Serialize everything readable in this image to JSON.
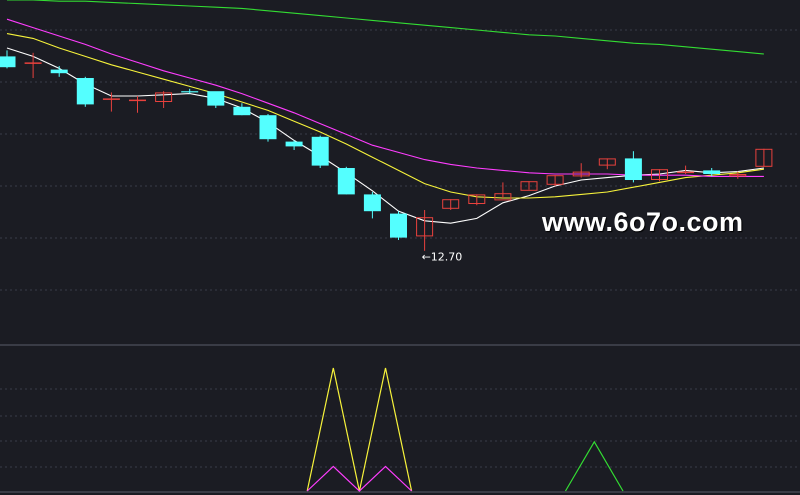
{
  "watermark": "www.6o7o.com",
  "colors": {
    "background": "#1b1c23",
    "grid": "#3a3d48",
    "up": "#e8413d",
    "down": "#54ffff",
    "ma5": "#ffffff",
    "ma10": "#f7f33b",
    "ma20": "#ff3dff",
    "ma60": "#33dd33",
    "low_label": "#ffffff"
  },
  "chart_data": {
    "type": "candlestick",
    "price_range": [
      12.17,
      14.82
    ],
    "low_marker": {
      "index": 16,
      "label": "←12.70",
      "value": 12.7
    },
    "candles": [
      {
        "o": 14.35,
        "h": 14.4,
        "l": 14.25,
        "c": 14.26
      },
      {
        "o": 14.3,
        "h": 14.38,
        "l": 14.17,
        "c": 14.3
      },
      {
        "o": 14.24,
        "h": 14.27,
        "l": 14.18,
        "c": 14.21
      },
      {
        "o": 14.17,
        "h": 14.18,
        "l": 13.93,
        "c": 13.95
      },
      {
        "o": 14.0,
        "h": 14.05,
        "l": 13.89,
        "c": 14.0
      },
      {
        "o": 13.99,
        "h": 14.02,
        "l": 13.88,
        "c": 13.99
      },
      {
        "o": 13.97,
        "h": 14.06,
        "l": 13.92,
        "c": 14.05
      },
      {
        "o": 14.06,
        "h": 14.08,
        "l": 14.04,
        "c": 14.05
      },
      {
        "o": 14.06,
        "h": 14.03,
        "l": 13.92,
        "c": 13.94
      },
      {
        "o": 13.93,
        "h": 13.96,
        "l": 13.86,
        "c": 13.86
      },
      {
        "o": 13.86,
        "h": 13.87,
        "l": 13.64,
        "c": 13.66
      },
      {
        "o": 13.64,
        "h": 13.65,
        "l": 13.57,
        "c": 13.6
      },
      {
        "o": 13.68,
        "h": 13.69,
        "l": 13.42,
        "c": 13.44
      },
      {
        "o": 13.42,
        "h": 13.43,
        "l": 13.2,
        "c": 13.2
      },
      {
        "o": 13.2,
        "h": 13.22,
        "l": 13.0,
        "c": 13.06
      },
      {
        "o": 13.04,
        "h": 13.06,
        "l": 12.82,
        "c": 12.84
      },
      {
        "o": 12.85,
        "h": 13.07,
        "l": 12.73,
        "c": 13.01
      },
      {
        "o": 13.08,
        "h": 13.16,
        "l": 13.07,
        "c": 13.16
      },
      {
        "o": 13.12,
        "h": 13.2,
        "l": 13.11,
        "c": 13.2
      },
      {
        "o": 13.15,
        "h": 13.3,
        "l": 13.17,
        "c": 13.21
      },
      {
        "o": 13.23,
        "h": 13.31,
        "l": 13.24,
        "c": 13.31
      },
      {
        "o": 13.28,
        "h": 13.36,
        "l": 13.27,
        "c": 13.36
      },
      {
        "o": 13.35,
        "h": 13.46,
        "l": 13.34,
        "c": 13.39
      },
      {
        "o": 13.44,
        "h": 13.5,
        "l": 13.41,
        "c": 13.5
      },
      {
        "o": 13.5,
        "h": 13.56,
        "l": 13.3,
        "c": 13.32
      },
      {
        "o": 13.32,
        "h": 13.41,
        "l": 13.31,
        "c": 13.41
      },
      {
        "o": 13.39,
        "h": 13.44,
        "l": 13.37,
        "c": 13.39
      },
      {
        "o": 13.4,
        "h": 13.42,
        "l": 13.35,
        "c": 13.37
      },
      {
        "o": 13.35,
        "h": 13.39,
        "l": 13.33,
        "c": 13.37
      },
      {
        "o": 13.43,
        "h": 13.58,
        "l": 13.43,
        "c": 13.58
      }
    ],
    "ma_series": [
      {
        "key": "ma5",
        "values": [
          14.42,
          14.35,
          14.25,
          14.12,
          14.02,
          14.02,
          14.03,
          14.04,
          14.0,
          13.92,
          13.8,
          13.65,
          13.52,
          13.38,
          13.23,
          13.06,
          12.98,
          12.96,
          13.0,
          13.13,
          13.19,
          13.27,
          13.32,
          13.34,
          13.36,
          13.37,
          13.4,
          13.38,
          13.39,
          13.42
        ]
      },
      {
        "key": "ma10",
        "values": [
          14.54,
          14.5,
          14.42,
          14.35,
          14.28,
          14.22,
          14.16,
          14.1,
          14.04,
          13.97,
          13.9,
          13.81,
          13.72,
          13.62,
          13.51,
          13.4,
          13.29,
          13.22,
          13.18,
          13.17,
          13.17,
          13.18,
          13.2,
          13.22,
          13.26,
          13.3,
          13.34,
          13.36,
          13.38,
          13.41
        ]
      },
      {
        "key": "ma20",
        "values": [
          14.66,
          14.59,
          14.52,
          14.45,
          14.37,
          14.3,
          14.23,
          14.17,
          14.11,
          14.04,
          13.96,
          13.88,
          13.79,
          13.7,
          13.61,
          13.55,
          13.49,
          13.45,
          13.42,
          13.4,
          13.38,
          13.37,
          13.37,
          13.37,
          13.36,
          13.36,
          13.36,
          13.35,
          13.35,
          13.35
        ]
      },
      {
        "key": "ma60",
        "values": [
          14.82,
          14.82,
          14.81,
          14.81,
          14.8,
          14.79,
          14.78,
          14.77,
          14.76,
          14.75,
          14.73,
          14.71,
          14.69,
          14.67,
          14.65,
          14.63,
          14.61,
          14.59,
          14.57,
          14.55,
          14.53,
          14.52,
          14.5,
          14.48,
          14.46,
          14.45,
          14.43,
          14.41,
          14.39,
          14.37
        ]
      }
    ],
    "sub_indicator": {
      "range": [
        0,
        100
      ],
      "series": [
        {
          "key": "yellow",
          "color": "#f7f33b",
          "points": [
            [
              11.5,
              0
            ],
            [
              12.5,
              100
            ],
            [
              13.5,
              0
            ],
            [
              14.5,
              100
            ],
            [
              15.5,
              0
            ]
          ]
        },
        {
          "key": "magenta",
          "color": "#ff3dff",
          "points": [
            [
              11.5,
              0
            ],
            [
              12.5,
              20
            ],
            [
              13.5,
              0
            ],
            [
              14.5,
              20
            ],
            [
              15.5,
              0
            ]
          ]
        },
        {
          "key": "green",
          "color": "#33dd33",
          "points": [
            [
              21.4,
              0
            ],
            [
              22.5,
              40
            ],
            [
              23.6,
              0
            ]
          ]
        }
      ]
    }
  }
}
